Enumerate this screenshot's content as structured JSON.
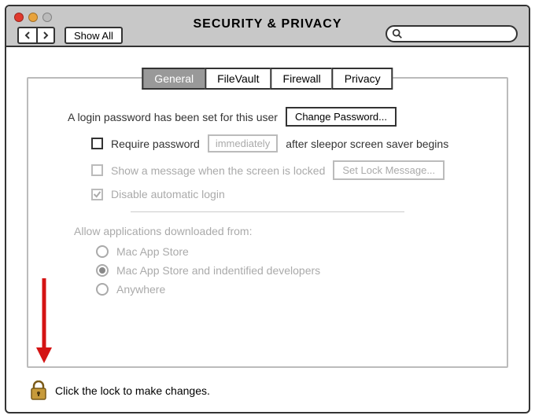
{
  "header": {
    "title": "SECURITY & PRIVACY",
    "show_all": "Show All",
    "search_placeholder": ""
  },
  "tabs": {
    "general": "General",
    "filevault": "FileVault",
    "firewall": "Firewall",
    "privacy": "Privacy"
  },
  "login": {
    "msg": "A login password has been set for this user",
    "change_btn": "Change Password...",
    "require_label": "Require password",
    "require_dropdown": "immediately",
    "require_suffix": "after sleepor screen saver begins",
    "show_msg_label": "Show a message when the screen is locked",
    "set_lock_btn": "Set Lock Message...",
    "disable_auto_label": "Disable automatic login"
  },
  "downloads": {
    "section": "Allow applications downloaded from:",
    "opt1": "Mac App Store",
    "opt2": "Mac App Store and indentified developers",
    "opt3": "Anywhere"
  },
  "lock_hint": "Click the lock to make changes."
}
